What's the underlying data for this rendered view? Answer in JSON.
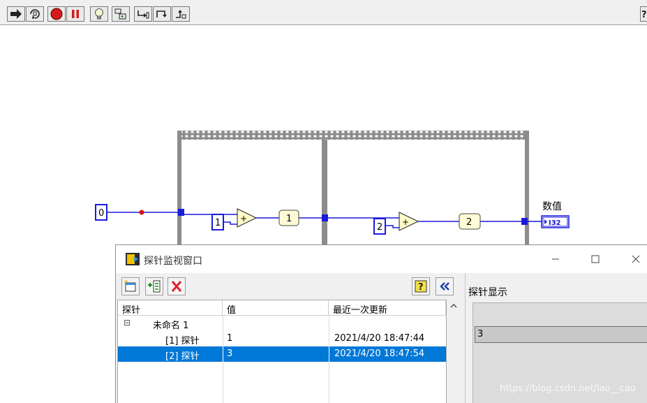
{
  "toolbar": {
    "buttons": [
      "run-arrow-icon",
      "retain-wire-values-icon",
      "abort-icon",
      "pause-icon",
      "highlight-execution-icon",
      "step-into-icon",
      "step-over-icon",
      "step-out-icon",
      "help-icon"
    ]
  },
  "diagram": {
    "constant_zero": "0",
    "constant_one": "1",
    "constant_two": "2",
    "probe_one": "1",
    "probe_two": "2",
    "indicator_label": "数值",
    "indicator_type": "I32",
    "wire_color": "#1a1adc"
  },
  "probe_window": {
    "title": "探针监视窗口",
    "toolbar": [
      "new-probe-icon",
      "add-probe-icon",
      "delete-icon",
      "help-icon",
      "collapse-icon"
    ],
    "columns": [
      "探针",
      "值",
      "最近一次更新"
    ],
    "group": {
      "toggle": "⊟",
      "label": "未命名 1"
    },
    "rows": [
      {
        "name": "[1] 探针",
        "value": "1",
        "updated": "2021/4/20 18:47:44",
        "selected": false
      },
      {
        "name": "[2] 探针",
        "value": "3",
        "updated": "2021/4/20 18:47:54",
        "selected": true
      }
    ],
    "display": {
      "label": "探针显示",
      "value": "3"
    },
    "watermark": "https://blog.csdn.net/lao__cao",
    "selection_color": "#0078d7"
  }
}
